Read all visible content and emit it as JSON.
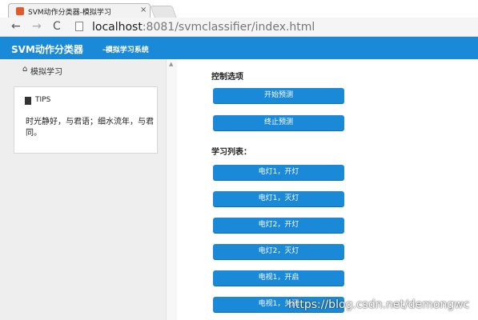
{
  "browser": {
    "tab_title": "SVM动作分类器-模拟学习",
    "tab_close": "×",
    "url_host": "localhost",
    "url_path": ":8081/svmclassifier/index.html"
  },
  "header": {
    "title": "SVM动作分类器",
    "subtitle": "-模拟学习系统",
    "color": "#1a8ad8"
  },
  "sidebar": {
    "sim_item": {
      "icon": "home-icon",
      "label": "模拟学习"
    },
    "tips": {
      "icon": "bookmark-icon",
      "title": "TIPS",
      "text": "时光静好，与君语；细水流年，与君同。"
    }
  },
  "main": {
    "control_title": "控制选项",
    "control_buttons": [
      "开始预测",
      "终止预测"
    ],
    "list_title": "学习列表：",
    "list_buttons": [
      "电灯1，开灯",
      "电灯1，灭灯",
      "电灯2，开灯",
      "电灯2，灭灯",
      "电视1，开启",
      "电视1，关闭"
    ]
  },
  "watermark": "https://blog.csdn.net/demongwc"
}
